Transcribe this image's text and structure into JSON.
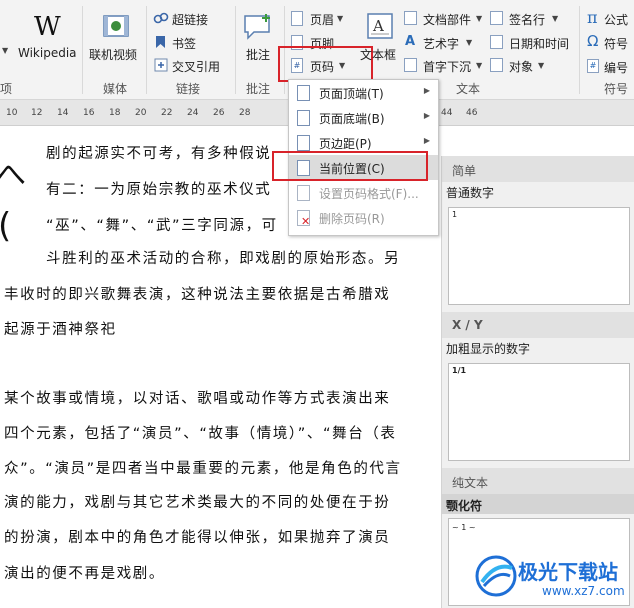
{
  "ribbon": {
    "wikipedia_glyph": "W",
    "wikipedia_label": "Wikipedia",
    "online_video_label": "联机视频",
    "hyperlink_label": "超链接",
    "bookmark_label": "书签",
    "cross_ref_label": "交叉引用",
    "comment_label": "批注",
    "header_label": "页眉",
    "footer_label": "页脚",
    "page_number_label": "页码",
    "textbox_label": "文本框",
    "doc_parts_label": "文档部件",
    "wordart_label": "艺术字",
    "dropcap_label": "首字下沉",
    "signature_label": "签名行",
    "datetime_label": "日期和时间",
    "object_label": "对象",
    "formula_label": "公式",
    "symbol_label": "符号",
    "number_label": "编号",
    "pi_glyph": "π",
    "omega_glyph": "Ω",
    "hash_glyph": "#",
    "groups": {
      "addins_partial": "项",
      "media": "媒体",
      "links": "链接",
      "comments": "批注",
      "text": "文本",
      "symbols": "符号"
    }
  },
  "ruler": {
    "ticks": [
      "10",
      "12",
      "14",
      "16",
      "18",
      "20",
      "22",
      "24",
      "26",
      "28",
      "44",
      "46"
    ]
  },
  "page_number_menu": {
    "items": [
      {
        "label": "页面顶端(T)",
        "has_arrow": true,
        "enabled": true
      },
      {
        "label": "页面底端(B)",
        "has_arrow": true,
        "enabled": true
      },
      {
        "label": "页边距(P)",
        "has_arrow": true,
        "enabled": true
      },
      {
        "label": "当前位置(C)",
        "has_arrow": true,
        "enabled": true
      },
      {
        "label": "设置页码格式(F)...",
        "has_arrow": false,
        "enabled": false
      },
      {
        "label": "删除页码(R)",
        "has_arrow": false,
        "enabled": false
      }
    ]
  },
  "gallery": {
    "sections": [
      {
        "header": "简单",
        "caption": "普通数字",
        "preview": "1"
      },
      {
        "header": "X / Y",
        "caption": "加粗显示的数字",
        "preview": "1/1"
      },
      {
        "header": "纯文本",
        "caption": "颚化符",
        "preview": "~ 1 ~"
      }
    ]
  },
  "document": {
    "big_glyph_1": "へ",
    "big_glyph_2": "(",
    "lines": [
      "剧的起源实不可考，有多种假说",
      "有二：一为原始宗教的巫术仪式",
      "“巫”、“舞”、“武”三字同源，可",
      "斗胜利的巫术活动的合称，即戏剧的原始形态。另",
      "丰收时的即兴歌舞表演，这种说法主要依据是古希腊戏",
      "起源于酒神祭祀",
      "某个故事或情境，以对话、歌唱或动作等方式表演出来",
      "四个元素，包括了“演员”、“故事（情境）”、“舞台（表",
      "众”。“演员”是四者当中最重要的元素，他是角色的代言",
      "演的能力，戏剧与其它艺术类最大的不同的处便在于扮",
      "的扮演，剧本中的角色才能得以伸张，如果抛弃了演员",
      "演出的便不再是戏剧。"
    ]
  },
  "watermark": {
    "brand": "极光下载站",
    "url": "www.xz7.com"
  },
  "colors": {
    "highlight_red": "#d8232a",
    "ribbon_bg": "#f3f3f3",
    "accent_blue": "#2b6cb8",
    "watermark_blue": "#1e6fd6"
  }
}
